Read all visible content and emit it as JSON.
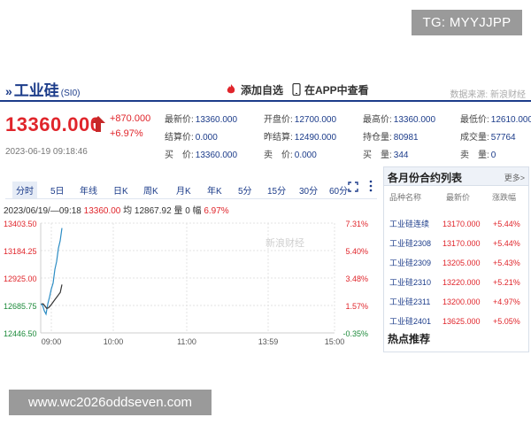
{
  "overlay": {
    "tg_badge": "TG: MYYJJPP",
    "url_banner": "www.wc2026oddseven.com"
  },
  "header": {
    "title": "工业硅",
    "code": "(SI0)",
    "add_watchlist": "添加自选",
    "view_in_app": "在APP中查看",
    "source": "数据来源: 新浪财经"
  },
  "quote": {
    "price": "13360.000",
    "change": "+870.000",
    "change_pct": "+6.97%",
    "timestamp": "2023-06-19 09:18:46"
  },
  "stats": [
    {
      "label": "最新价:",
      "value": "13360.000"
    },
    {
      "label": "开盘价:",
      "value": "12700.000"
    },
    {
      "label": "最高价:",
      "value": "13360.000"
    },
    {
      "label": "最低价:",
      "value": "12610.000"
    },
    {
      "label": "结算价:",
      "value": "0.000"
    },
    {
      "label": "昨结算:",
      "value": "12490.000"
    },
    {
      "label": "持仓量:",
      "value": "80981"
    },
    {
      "label": "成交量:",
      "value": "57764"
    },
    {
      "label": "买　价:",
      "value": "13360.000"
    },
    {
      "label": "卖　价:",
      "value": "0.000"
    },
    {
      "label": "买　量:",
      "value": "344"
    },
    {
      "label": "卖　量:",
      "value": "0"
    }
  ],
  "tabs": [
    "分时",
    "5日",
    "年线",
    "日K",
    "周K",
    "月K",
    "年K",
    "5分",
    "15分",
    "30分",
    "60分"
  ],
  "quote_line": {
    "range": "2023/06/19/—09:18",
    "price": "13360.00",
    "avg_label": "均",
    "avg": "12867.92",
    "vol_label": "量",
    "vol": "0",
    "chg_label": "幅",
    "chg": "6.97%"
  },
  "chart_data": {
    "type": "line",
    "y_ticks": [
      "13403.50",
      "13184.25",
      "12925.00",
      "12685.75",
      "12446.50"
    ],
    "pct_ticks": [
      "7.31%",
      "5.40%",
      "3.48%",
      "1.57%",
      "-0.35%"
    ],
    "x_ticks": [
      "09:00",
      "10:00",
      "11:00",
      "13:59",
      "15:00"
    ],
    "ylim": [
      12446.5,
      13403.5
    ],
    "series": [
      {
        "name": "price",
        "color": "#2b8cc4",
        "values": [
          12700,
          12690,
          12640,
          12610,
          12700,
          12760,
          12830,
          12880,
          13000,
          13070,
          13184,
          13250,
          13360
        ]
      },
      {
        "name": "avg",
        "color": "#333333",
        "values": [
          12700,
          12700,
          12680,
          12660,
          12665,
          12680,
          12700,
          12720,
          12740,
          12760,
          12780,
          12800,
          12868
        ]
      }
    ],
    "watermark": "新浪财经",
    "grid": true
  },
  "contracts_panel": {
    "title": "各月份合约列表",
    "more": "更多>",
    "columns": [
      "品种名称",
      "最新价",
      "涨跌幅"
    ],
    "rows": [
      {
        "name": "工业硅连续",
        "price": "13170.000",
        "pct": "+5.44%"
      },
      {
        "name": "工业硅2308",
        "price": "13170.000",
        "pct": "+5.44%"
      },
      {
        "name": "工业硅2309",
        "price": "13205.000",
        "pct": "+5.43%"
      },
      {
        "name": "工业硅2310",
        "price": "13220.000",
        "pct": "+5.21%"
      },
      {
        "name": "工业硅2311",
        "price": "13200.000",
        "pct": "+4.97%"
      },
      {
        "name": "工业硅2401",
        "price": "13625.000",
        "pct": "+5.05%"
      }
    ]
  },
  "hot": "热点推荐",
  "colors": {
    "up": "#e0252b",
    "brand": "#1c3c8a",
    "line": "#2b8cc4"
  }
}
